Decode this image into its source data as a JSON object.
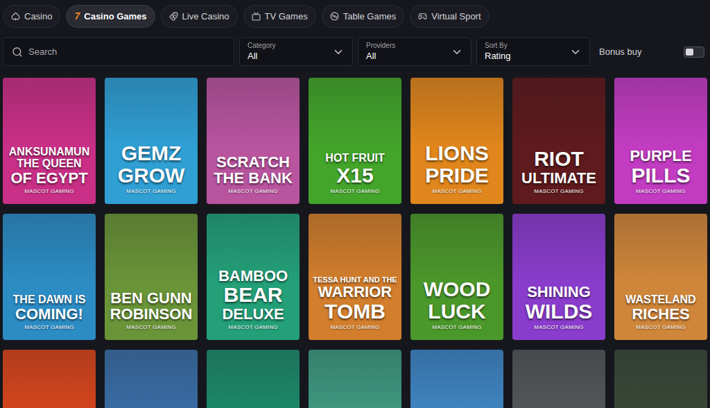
{
  "tabs": [
    {
      "label": "Casino",
      "selected": false,
      "glyph": ""
    },
    {
      "label": "Casino Games",
      "selected": true,
      "glyph": "7"
    },
    {
      "label": "Live Casino",
      "selected": false,
      "glyph": ""
    },
    {
      "label": "TV Games",
      "selected": false,
      "glyph": ""
    },
    {
      "label": "Table Games",
      "selected": false,
      "glyph": ""
    },
    {
      "label": "Virtual Sport",
      "selected": false,
      "glyph": ""
    }
  ],
  "filters": {
    "search": {
      "placeholder": "Search"
    },
    "dropdowns": [
      {
        "label": "Category",
        "value": "All"
      },
      {
        "label": "Providers",
        "value": "All"
      },
      {
        "label": "Sort By",
        "value": "Rating"
      }
    ],
    "bonus_buy": {
      "label": "Bonus buy",
      "on": false
    }
  },
  "games": [
    {
      "title": [
        "ANKSUNAMUN",
        "THE QUEEN",
        "OF EGYPT"
      ],
      "provider": "MASCOT GAMING",
      "color": "#c92f86"
    },
    {
      "title": [
        "GEMZ",
        "GROW"
      ],
      "provider": "MASCOT GAMING",
      "color": "#2f9fd4"
    },
    {
      "title": [
        "SCRATCH",
        "THE BANK"
      ],
      "provider": "MASCOT GAMING",
      "color": "#b9549f"
    },
    {
      "title": [
        "HOT FRUIT",
        "X15"
      ],
      "provider": "MASCOT GAMING",
      "color": "#43a52a"
    },
    {
      "title": [
        "LIONS",
        "PRIDE"
      ],
      "provider": "MASCOT GAMING",
      "color": "#e0861c"
    },
    {
      "title": [
        "RIOT",
        "ULTIMATE"
      ],
      "provider": "MASCOT GAMING",
      "color": "#5e1a1c"
    },
    {
      "title": [
        "PURPLE",
        "PILLS"
      ],
      "provider": "MASCOT GAMING",
      "color": "#c23cc2"
    },
    {
      "title": [
        "THE DAWN IS",
        "COMING!"
      ],
      "provider": "MASCOT GAMING",
      "color": "#2c8cc4"
    },
    {
      "title": [
        "BEN GUNN",
        "ROBINSON"
      ],
      "provider": "MASCOT GAMING",
      "color": "#6a9438"
    },
    {
      "title": [
        "BAMBOO",
        "BEAR",
        "DELUXE"
      ],
      "provider": "MASCOT GAMING",
      "color": "#23a078"
    },
    {
      "title": [
        "TESSA HUNT AND THE",
        "WARRIOR",
        "TOMB"
      ],
      "provider": "MASCOT GAMING",
      "color": "#d27e2c"
    },
    {
      "title": [
        "WOOD",
        "LUCK"
      ],
      "provider": "MASCOT GAMING",
      "color": "#4b982a"
    },
    {
      "title": [
        "SHINING",
        "WILDS"
      ],
      "provider": "MASCOT GAMING",
      "color": "#8a3ccc"
    },
    {
      "title": [
        "WASTELAND",
        "RICHES"
      ],
      "provider": "MASCOT GAMING",
      "color": "#d0863a"
    },
    {
      "title": [],
      "provider": "",
      "color": "#d8461c"
    },
    {
      "title": [],
      "provider": "",
      "color": "#3a6ea6"
    },
    {
      "title": [],
      "provider": "",
      "color": "#1d8a6a"
    },
    {
      "title": [],
      "provider": "",
      "color": "#3e9a80"
    },
    {
      "title": [],
      "provider": "",
      "color": "#3f86c4"
    },
    {
      "title": [],
      "provider": "",
      "color": "#55565a"
    },
    {
      "title": [],
      "provider": "",
      "color": "#3a4838"
    }
  ]
}
